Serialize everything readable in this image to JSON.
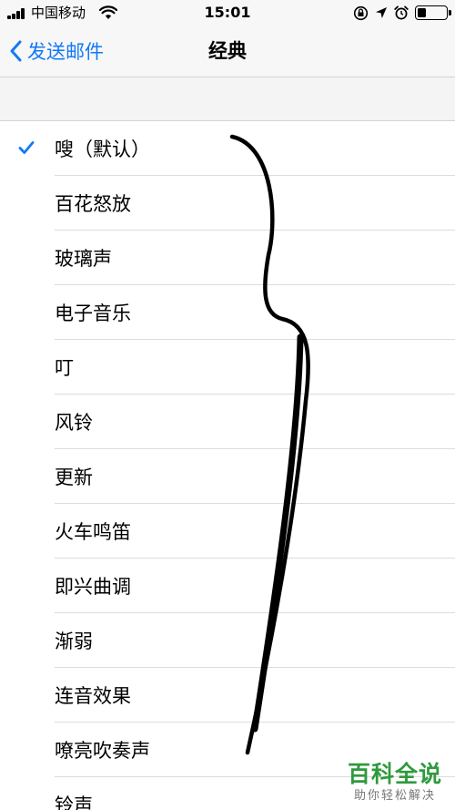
{
  "status_bar": {
    "carrier": "中国移动",
    "time": "15:01",
    "battery_level": 0.3
  },
  "nav": {
    "back_label": "发送邮件",
    "title": "经典"
  },
  "sounds": [
    {
      "label": "嗖（默认）",
      "selected": true
    },
    {
      "label": "百花怒放",
      "selected": false
    },
    {
      "label": "玻璃声",
      "selected": false
    },
    {
      "label": "电子音乐",
      "selected": false
    },
    {
      "label": "叮",
      "selected": false
    },
    {
      "label": "风铃",
      "selected": false
    },
    {
      "label": "更新",
      "selected": false
    },
    {
      "label": "火车鸣笛",
      "selected": false
    },
    {
      "label": "即兴曲调",
      "selected": false
    },
    {
      "label": "渐弱",
      "selected": false
    },
    {
      "label": "连音效果",
      "selected": false
    },
    {
      "label": "嘹亮吹奏声",
      "selected": false
    },
    {
      "label": "铃声",
      "selected": false
    }
  ],
  "watermark": {
    "title": "百科全说",
    "subtitle": "助你轻松解决"
  },
  "colors": {
    "accent": "#1279f6",
    "watermark": "#2f9a3d"
  },
  "icons": [
    "signal-icon",
    "wifi-icon",
    "location-lock-icon",
    "location-arrow-icon",
    "alarm-icon",
    "battery-icon",
    "chevron-left-icon",
    "checkmark-icon"
  ]
}
